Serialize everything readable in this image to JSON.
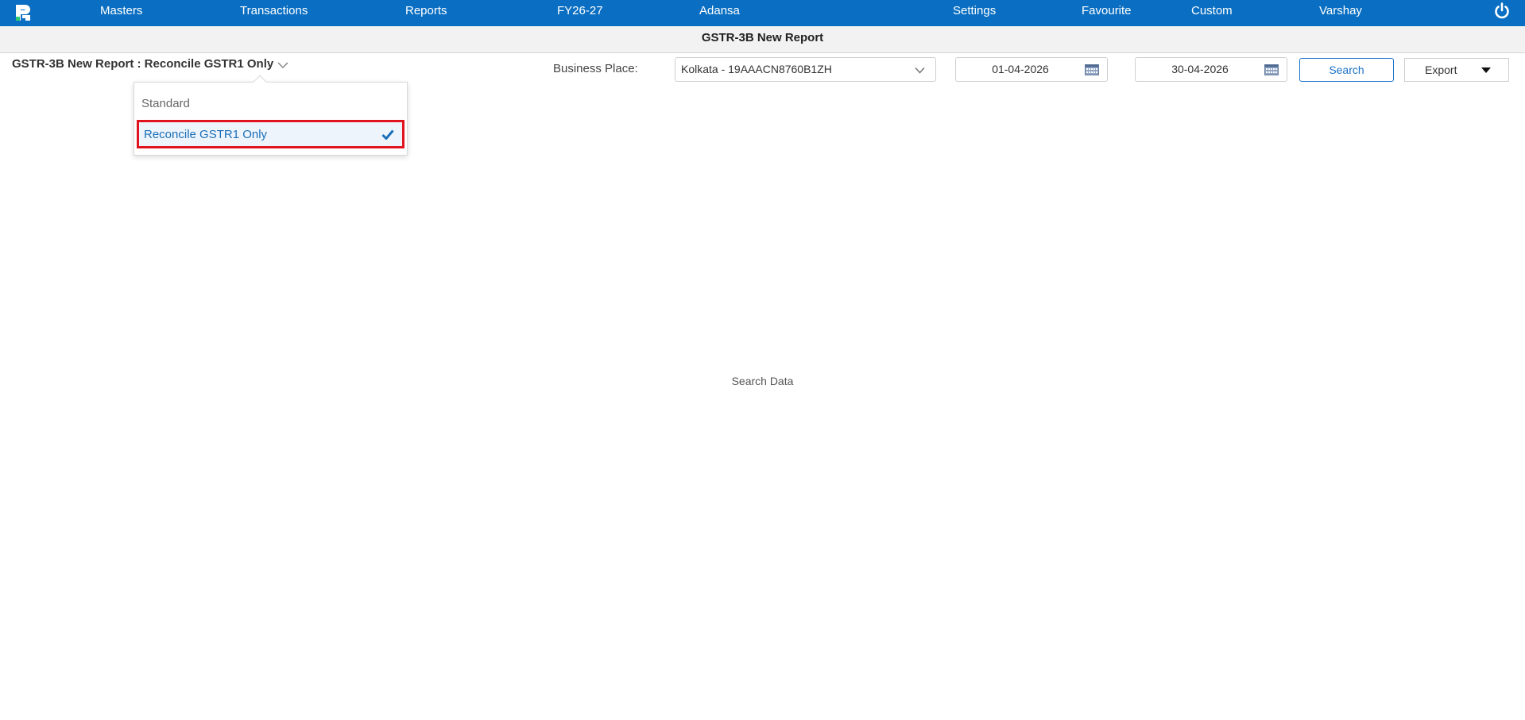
{
  "topbar": {
    "logo_icon": "app-logo-icon",
    "nav": {
      "masters": "Masters",
      "transactions": "Transactions",
      "reports": "Reports",
      "fy": "FY26-27",
      "company": "Adansa",
      "settings": "Settings",
      "favourite": "Favourite",
      "custom": "Custom",
      "user": "Varshay"
    },
    "power_icon": "power-icon",
    "bg_color": "#0a6fc2"
  },
  "subheader": {
    "title": "GSTR-3B New Report"
  },
  "report_selector": {
    "title": "GSTR-3B New Report : Reconcile GSTR1 Only",
    "options": [
      "Standard",
      "Reconcile GSTR1 Only"
    ],
    "selected": "Reconcile GSTR1 Only",
    "highlight_color": "#e0141e"
  },
  "filters": {
    "business_place_label": "Business Place:",
    "business_place_value": "Kolkata - 19AAACN8760B1ZH",
    "from_date": "01-04-2026",
    "to_date": "30-04-2026",
    "search_label": "Search",
    "export_label": "Export"
  },
  "main": {
    "empty_message": "Search Data"
  }
}
